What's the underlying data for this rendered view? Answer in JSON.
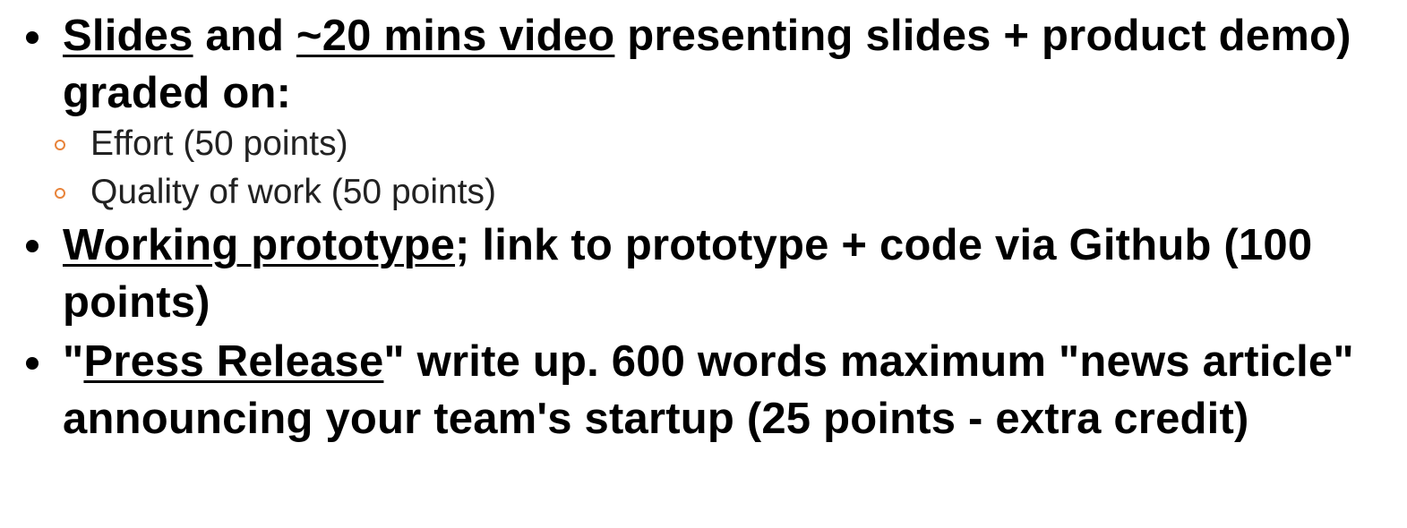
{
  "bullets": {
    "b1": {
      "part1": "Slides",
      "part2": " and ",
      "part3": "~20 mins video",
      "part4": " presenting slides + product demo) graded on:",
      "subitems": [
        "Effort (50 points)",
        "Quality of work (50 points)"
      ]
    },
    "b2": {
      "part1": "Working prototype",
      "part2": "; link to prototype + code via Github (100 points)"
    },
    "b3": {
      "part1": "\"",
      "part2": "Press Release",
      "part3": "\" write up. 600 words maximum \"news article\" announcing your team's startup (25 points - extra credit)"
    }
  },
  "colors": {
    "text": "#000000",
    "sub_bullet_ring": "#e8833a",
    "background": "#ffffff"
  },
  "icons": {
    "main_bullet": "filled-circle-bullet",
    "sub_bullet": "hollow-circle-bullet"
  }
}
